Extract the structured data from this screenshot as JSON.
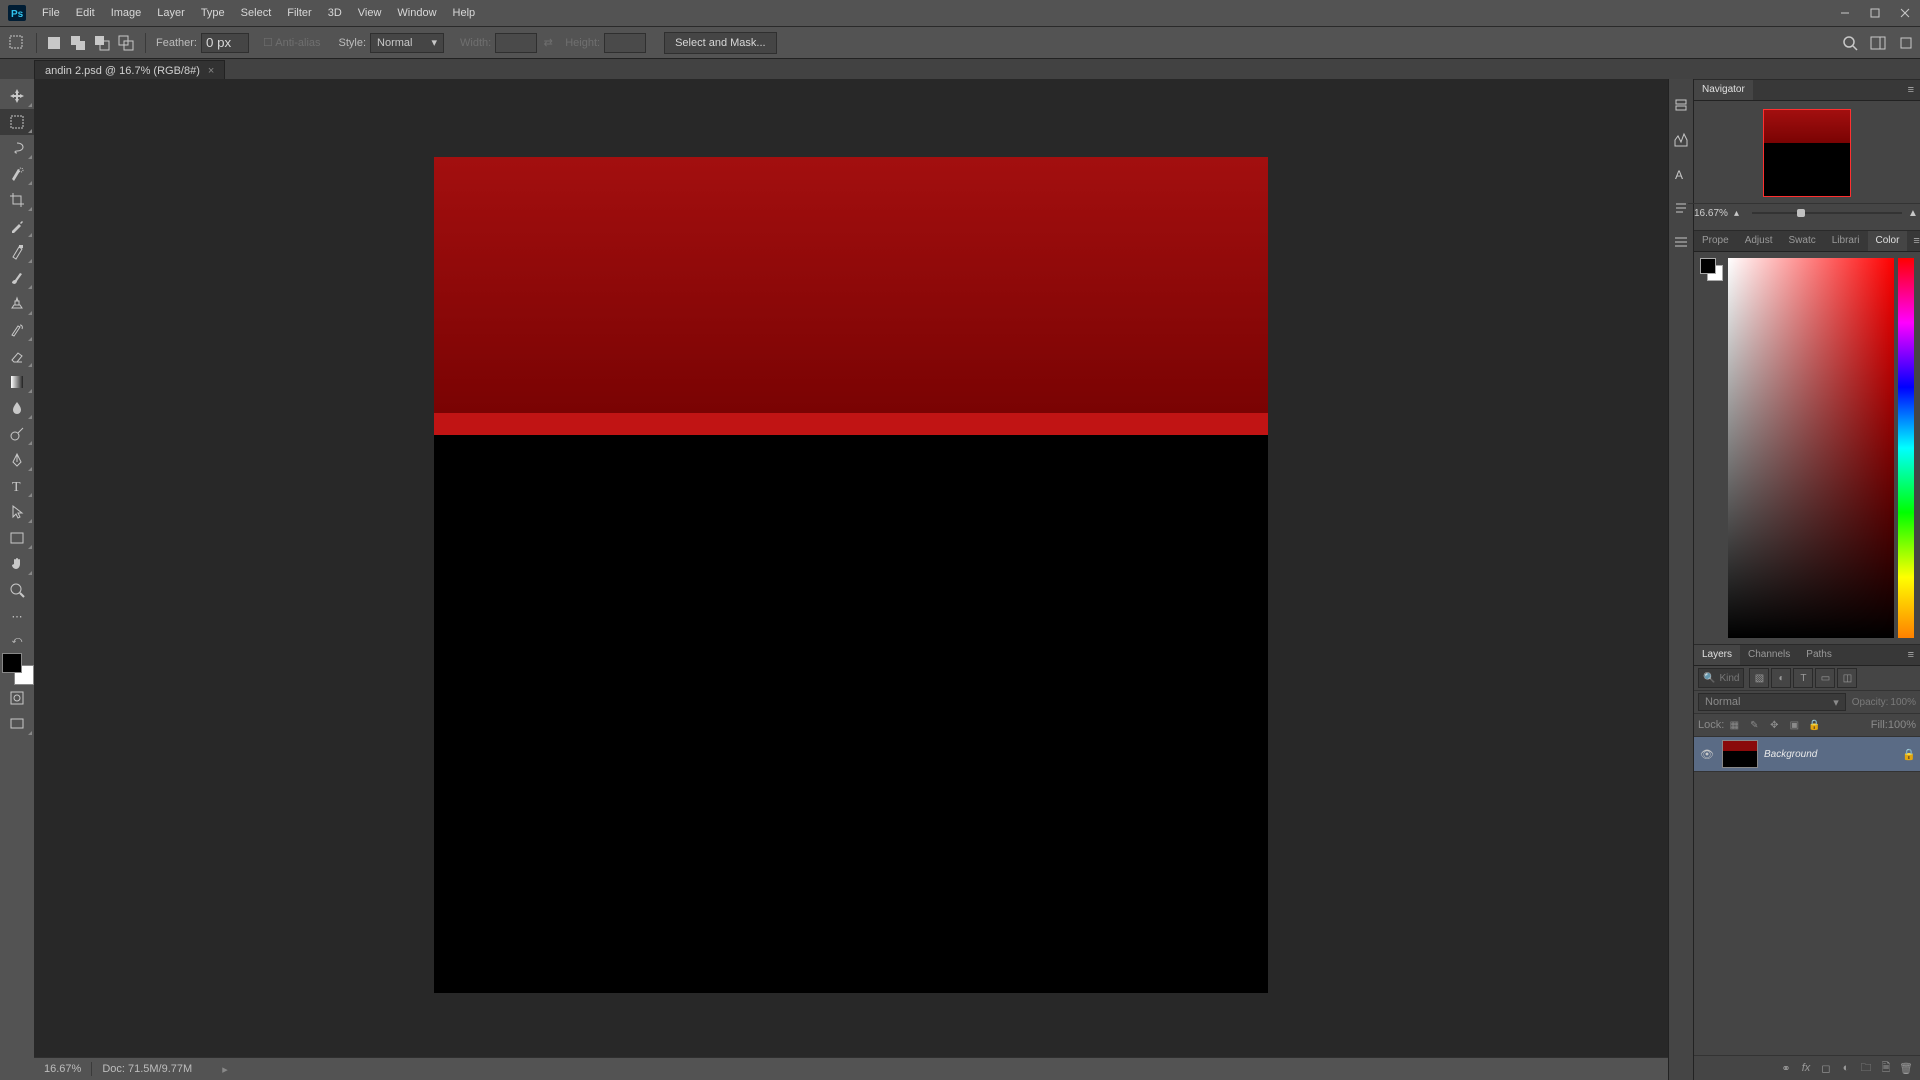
{
  "menu": {
    "items": [
      "File",
      "Edit",
      "Image",
      "Layer",
      "Type",
      "Select",
      "Filter",
      "3D",
      "View",
      "Window",
      "Help"
    ]
  },
  "options": {
    "feather_label": "Feather:",
    "feather_value": "0 px",
    "antialias_label": "Anti-alias",
    "style_label": "Style:",
    "style_value": "Normal",
    "width_label": "Width:",
    "height_label": "Height:",
    "select_mask_label": "Select and Mask..."
  },
  "tab": {
    "title": "andin 2.psd @ 16.7% (RGB/8#)"
  },
  "navigator": {
    "tab": "Navigator",
    "zoom": "16.67%"
  },
  "props_tabs": [
    "Prope",
    "Adjust",
    "Swatc",
    "Librari",
    "Color"
  ],
  "layers_tabs": [
    "Layers",
    "Channels",
    "Paths"
  ],
  "layers": {
    "filter_placeholder": "Kind",
    "blend_mode": "Normal",
    "opacity_label": "Opacity:",
    "opacity_value": "100%",
    "lock_label": "Lock:",
    "fill_label": "Fill:",
    "fill_value": "100%",
    "layer_name": "Background"
  },
  "status": {
    "zoom": "16.67%",
    "doc": "Doc: 71.5M/9.77M"
  }
}
